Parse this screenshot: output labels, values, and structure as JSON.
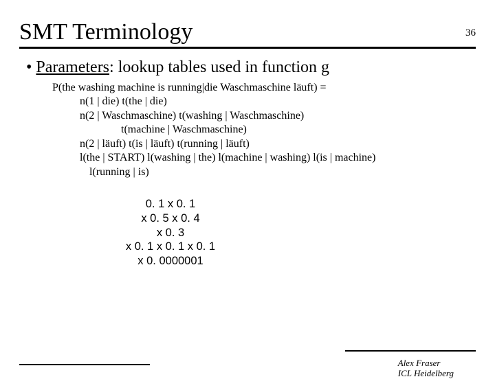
{
  "page_number": "36",
  "title": "SMT Terminology",
  "bullet": {
    "marker": "•",
    "label": "Parameters",
    "rest": ": lookup tables used in function g"
  },
  "lines": {
    "l1": "P(the washing machine is running|die Waschmaschine läuft) =",
    "l2": "n(1 | die) t(the | die)",
    "l3": "n(2 | Waschmaschine)  t(washing | Waschmaschine)",
    "l4": "t(machine | Waschmaschine)",
    "l5": "n(2 | läuft) t(is | läuft) t(running | läuft)",
    "l6": "l(the | START) l(washing | the) l(machine | washing) l(is | machine)",
    "l7": "l(running | is)"
  },
  "numbers": {
    "n1": "0. 1 x 0. 1",
    "n2": "x 0. 5 x 0. 4",
    "n3": "x 0. 3",
    "n4": "x 0. 1 x 0. 1 x 0. 1",
    "n5": "x 0. 0000001"
  },
  "footer": {
    "line1": "Alex Fraser",
    "line2": "ICL Heidelberg"
  }
}
